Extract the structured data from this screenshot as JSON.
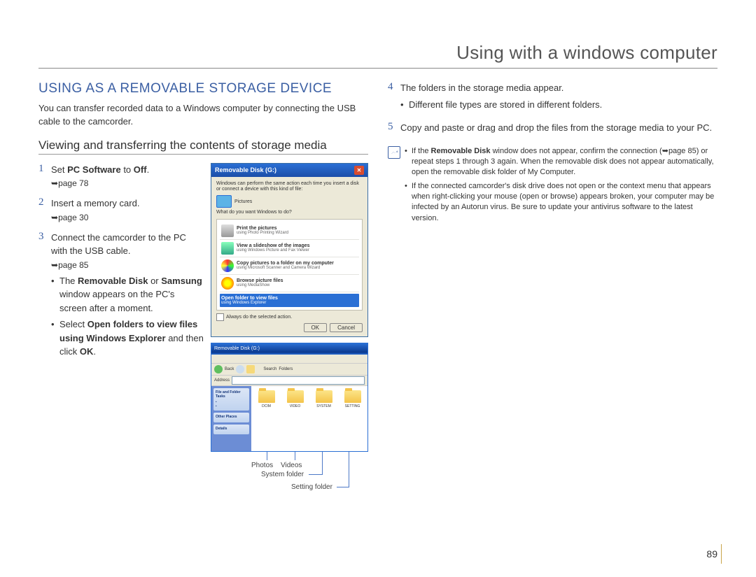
{
  "chapter_title": "Using with a windows computer",
  "page_number": "89",
  "section_heading": "USING AS A REMOVABLE STORAGE DEVICE",
  "intro": "You can transfer recorded data to a Windows computer by connecting the USB cable to the camcorder.",
  "subsection_heading": "Viewing and transferring the contents of storage media",
  "steps": {
    "1": {
      "text_pre": "Set ",
      "bold1": "PC Software",
      "mid": " to ",
      "bold2": "Off",
      "post": ".",
      "ref": "page 78"
    },
    "2": {
      "text": "Insert a memory card.",
      "ref": "page 30"
    },
    "3": {
      "text": "Connect the camcorder to the PC with the USB cable.",
      "ref": "page 85",
      "bullets": {
        "a_pre": "The ",
        "a_b1": "Removable Disk",
        "a_mid": " or ",
        "a_b2": "Samsung",
        "a_post": " window appears on the PC's screen after a moment.",
        "b_pre": "Select ",
        "b_b1": "Open folders to view files using Windows Explorer",
        "b_mid": " and then click ",
        "b_b2": "OK",
        "b_post": "."
      }
    },
    "4": {
      "text": "The folders in the storage media appear.",
      "bullet": "Different file types are stored in different folders."
    },
    "5": {
      "text": "Copy and paste or drag and drop the files from the storage media to your PC."
    }
  },
  "dialog": {
    "title": "Removable Disk (G:)",
    "hint": "Windows can perform the same action each time you insert a disk or connect a device with this kind of file:",
    "pictures_label": "Pictures",
    "prompt": "What do you want Windows to do?",
    "opts": {
      "print": {
        "title": "Print the pictures",
        "sub": "using Photo Printing Wizard"
      },
      "slideshow": {
        "title": "View a slideshow of the images",
        "sub": "using Windows Picture and Fax Viewer"
      },
      "copy": {
        "title": "Copy pictures to a folder on my computer",
        "sub": "using Microsoft Scanner and Camera Wizard"
      },
      "browse": {
        "title": "Browse picture files",
        "sub": "using MediaShow"
      },
      "open": {
        "title": "Open folder to view files",
        "sub": "using Windows Explorer"
      }
    },
    "always": "Always do the selected action.",
    "ok": "OK",
    "cancel": "Cancel"
  },
  "explorer": {
    "title": "Removable Disk (G:)",
    "back": "Back",
    "search": "Search",
    "folders_btn": "Folders",
    "address": "Address",
    "side": {
      "panel1_title": "File and Folder Tasks",
      "panel2_title": "Other Places",
      "panel3_title": "Details"
    },
    "folders": [
      "DCIM",
      "VIDEO",
      "SYSTEM",
      "SETTING"
    ]
  },
  "callouts": {
    "photos": "Photos",
    "videos": "Videos",
    "system": "System folder",
    "setting": "Setting folder"
  },
  "note": {
    "a_pre": "If the ",
    "a_b": "Removable Disk",
    "a_post": " window does not appear, confirm the connection (",
    "a_ref": "page 85",
    "a_tail": ") or repeat steps 1 through 3 again. When the removable disk does not appear automatically, open the removable disk folder of My Computer.",
    "b": "If the connected camcorder's disk drive does not open or the context menu that appears when right-clicking your mouse (open or browse) appears broken, your computer may be infected by an Autorun virus. Be sure to update your antivirus software to the latest version."
  }
}
